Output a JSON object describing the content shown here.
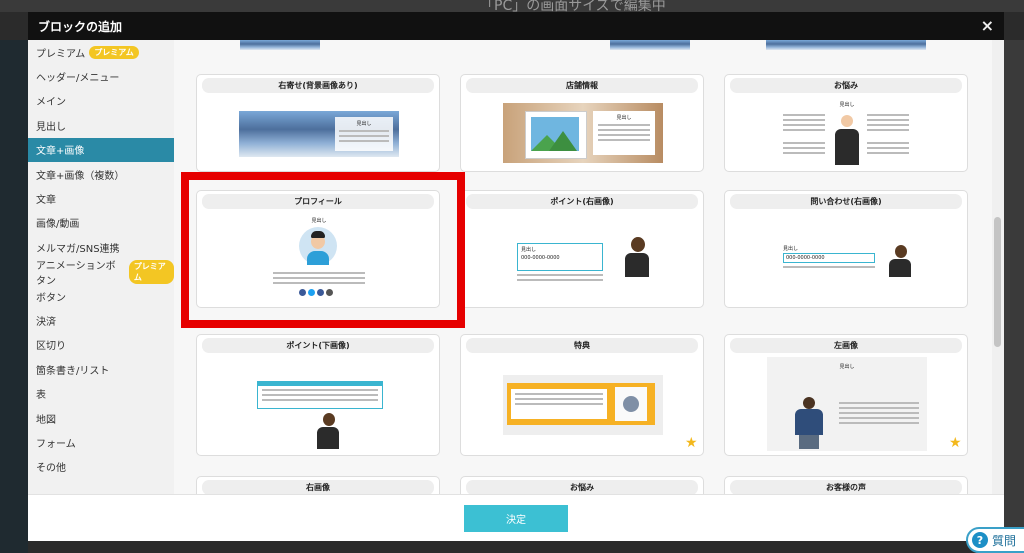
{
  "background": {
    "text": "「PC」の画面サイズで編集中"
  },
  "modal": {
    "title": "ブロックの追加",
    "close_label": "×",
    "confirm_label": "決定"
  },
  "sidebar": {
    "items": [
      {
        "label": "プレミアム",
        "badge": "プレミアム"
      },
      {
        "label": "ヘッダー/メニュー"
      },
      {
        "label": "メイン"
      },
      {
        "label": "見出し"
      },
      {
        "label": "文章+画像",
        "active": true
      },
      {
        "label": "文章+画像（複数）"
      },
      {
        "label": "文章"
      },
      {
        "label": "画像/動画"
      },
      {
        "label": "メルマガ/SNS連携"
      },
      {
        "label": "アニメーションボタン",
        "badge": "プレミアム"
      },
      {
        "label": "ボタン"
      },
      {
        "label": "決済"
      },
      {
        "label": "区切り"
      },
      {
        "label": "箇条書き/リスト"
      },
      {
        "label": "表"
      },
      {
        "label": "地図"
      },
      {
        "label": "フォーム"
      },
      {
        "label": "その他"
      }
    ]
  },
  "cards": [
    {
      "caption": "右寄せ(背景画像あり)"
    },
    {
      "caption": "店舗情報"
    },
    {
      "caption": "お悩み"
    },
    {
      "caption": "プロフィール"
    },
    {
      "caption": "ポイント(右画像)"
    },
    {
      "caption": "問い合わせ(右画像)"
    },
    {
      "caption": "ポイント(下画像)"
    },
    {
      "caption": "特典"
    },
    {
      "caption": "左画像"
    },
    {
      "caption": "右画像"
    },
    {
      "caption": "お悩み"
    },
    {
      "caption": "お客様の声"
    }
  ],
  "thumb_text": {
    "heading": "見出し",
    "phone": "000-0000-0000"
  },
  "help": {
    "label": "質問"
  },
  "colors": {
    "accent": "#2a8aa6",
    "confirm": "#3cc0d3",
    "badge": "#f3c623",
    "highlight": "#e60000"
  }
}
